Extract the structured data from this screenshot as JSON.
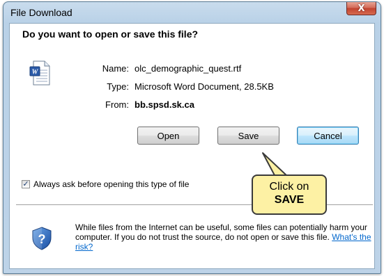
{
  "window": {
    "title": "File Download",
    "close_label": "X"
  },
  "dialog": {
    "question": "Do you want to open or save this file?",
    "file": {
      "icon": "word-document-icon",
      "name_label": "Name:",
      "name_value": "olc_demographic_quest.rtf",
      "type_label": "Type:",
      "type_value": "Microsoft Word Document, 28.5KB",
      "from_label": "From:",
      "from_value": "bb.spsd.sk.ca"
    },
    "buttons": {
      "open": "Open",
      "save": "Save",
      "cancel": "Cancel"
    },
    "checkbox": {
      "label": "Always ask before opening this type of file",
      "checked": true
    },
    "warning": {
      "icon": "shield-question-icon",
      "text": "While files from the Internet can be useful, some files can potentially harm your computer. If you do not trust the source, do not open or save this file.",
      "link": "What's the risk?"
    }
  },
  "callout": {
    "line1": "Click on",
    "line2": "SAVE"
  },
  "colors": {
    "frame": "#bdd3e8",
    "close_button": "#c1432f",
    "default_button": "#3c7fb1",
    "link": "#0066cc",
    "callout_fill": "#fdf1a4"
  }
}
